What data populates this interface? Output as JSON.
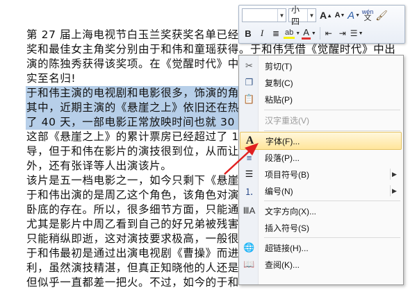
{
  "document": {
    "lines": [
      {
        "text": "第 27 届上海电视节白玉兰奖获奖名单已经",
        "selected": false
      },
      {
        "text": "奖和最佳女主角奖分别由于和伟和童瑶获得。于和伟凭借《觉醒时代》中出",
        "selected": false
      },
      {
        "text": "演的陈独秀获得该奖项。在《觉醒时代》中",
        "selected": false
      },
      {
        "text": "实至名归!",
        "selected": false
      },
      {
        "text": "于和伟主演的电视剧和电影很多，饰演的角",
        "selected": true
      },
      {
        "text": "其中，近期主演的《悬崖之上》依旧还在热",
        "selected": true
      },
      {
        "text": "了 40 天，一部电影正常放映时间也就 30 天",
        "selected": true
      },
      {
        "text": "这部《悬崖之上》的累计票房已经超过了 1",
        "selected": false
      },
      {
        "text": "导，但于和伟在影片的演技很到位，从而让",
        "selected": false
      },
      {
        "text": "外，还有张译等人出演该片。",
        "selected": false
      },
      {
        "text": "该片是五一档电影之一，如今只剩下《悬崖",
        "selected": false
      },
      {
        "text": "于和伟出演的是周乙这个角色，该角色对演",
        "selected": false
      },
      {
        "text": "卧底的存在。所以，很多细节方面，只能通",
        "selected": false
      },
      {
        "text": "尤其是影片中周乙看到自己的好兄弟被残害",
        "selected": false
      },
      {
        "text": "只能稍纵即逝，这对演技要求极高，一般很",
        "selected": false
      },
      {
        "text": "于和伟最初是通过出演电视剧《曹操》而进",
        "selected": false
      },
      {
        "text": "利，虽然演技精湛，但真正知晓他的人还是",
        "selected": false
      },
      {
        "text": "但似乎一直都差一把火。不过，如今的于和",
        "selected": false
      }
    ]
  },
  "mini_toolbar": {
    "font_name": "",
    "font_size": "小四",
    "grow_icon": "A",
    "shrink_icon": "A",
    "style_icon": "A",
    "pinyin_icon": "wén",
    "bold": "B",
    "italic": "I",
    "font_color": "A"
  },
  "context_menu": {
    "items": [
      {
        "label": "剪切(T)",
        "icon": "scissors-icon",
        "glyph": "✂",
        "enabled": true,
        "submenu": false
      },
      {
        "label": "复制(C)",
        "icon": "copy-icon",
        "glyph": "❐",
        "enabled": true,
        "submenu": false
      },
      {
        "label": "粘贴(P)",
        "icon": "paste-icon",
        "glyph": "📋",
        "enabled": true,
        "submenu": false
      },
      {
        "label": "汉字重选(V)",
        "icon": "",
        "glyph": "",
        "enabled": false,
        "submenu": false
      },
      {
        "label": "字体(F)...",
        "icon": "font-icon",
        "glyph": "A",
        "enabled": true,
        "submenu": false,
        "highlighted": true
      },
      {
        "label": "段落(P)...",
        "icon": "paragraph-icon",
        "glyph": "≡",
        "enabled": true,
        "submenu": false
      },
      {
        "label": "项目符号(B)",
        "icon": "bullets-icon",
        "glyph": "☰",
        "enabled": true,
        "submenu": true
      },
      {
        "label": "编号(N)",
        "icon": "numbering-icon",
        "glyph": "⒈",
        "enabled": true,
        "submenu": true
      },
      {
        "label": "文字方向(X)...",
        "icon": "text-direction-icon",
        "glyph": "ℿ",
        "enabled": true,
        "submenu": false
      },
      {
        "label": "插入符号(S)",
        "icon": "",
        "glyph": "",
        "enabled": true,
        "submenu": false
      },
      {
        "label": "超链接(H)...",
        "icon": "hyperlink-icon",
        "glyph": "🌐",
        "enabled": true,
        "submenu": false
      },
      {
        "label": "查阅(K)...",
        "icon": "lookup-icon",
        "glyph": "📖",
        "enabled": true,
        "submenu": false
      }
    ]
  },
  "colors": {
    "selection": "#b7cfe9",
    "highlight_fill": "#ffe59a",
    "font_color_bar": "#e03030",
    "arrow": "#e02020"
  }
}
